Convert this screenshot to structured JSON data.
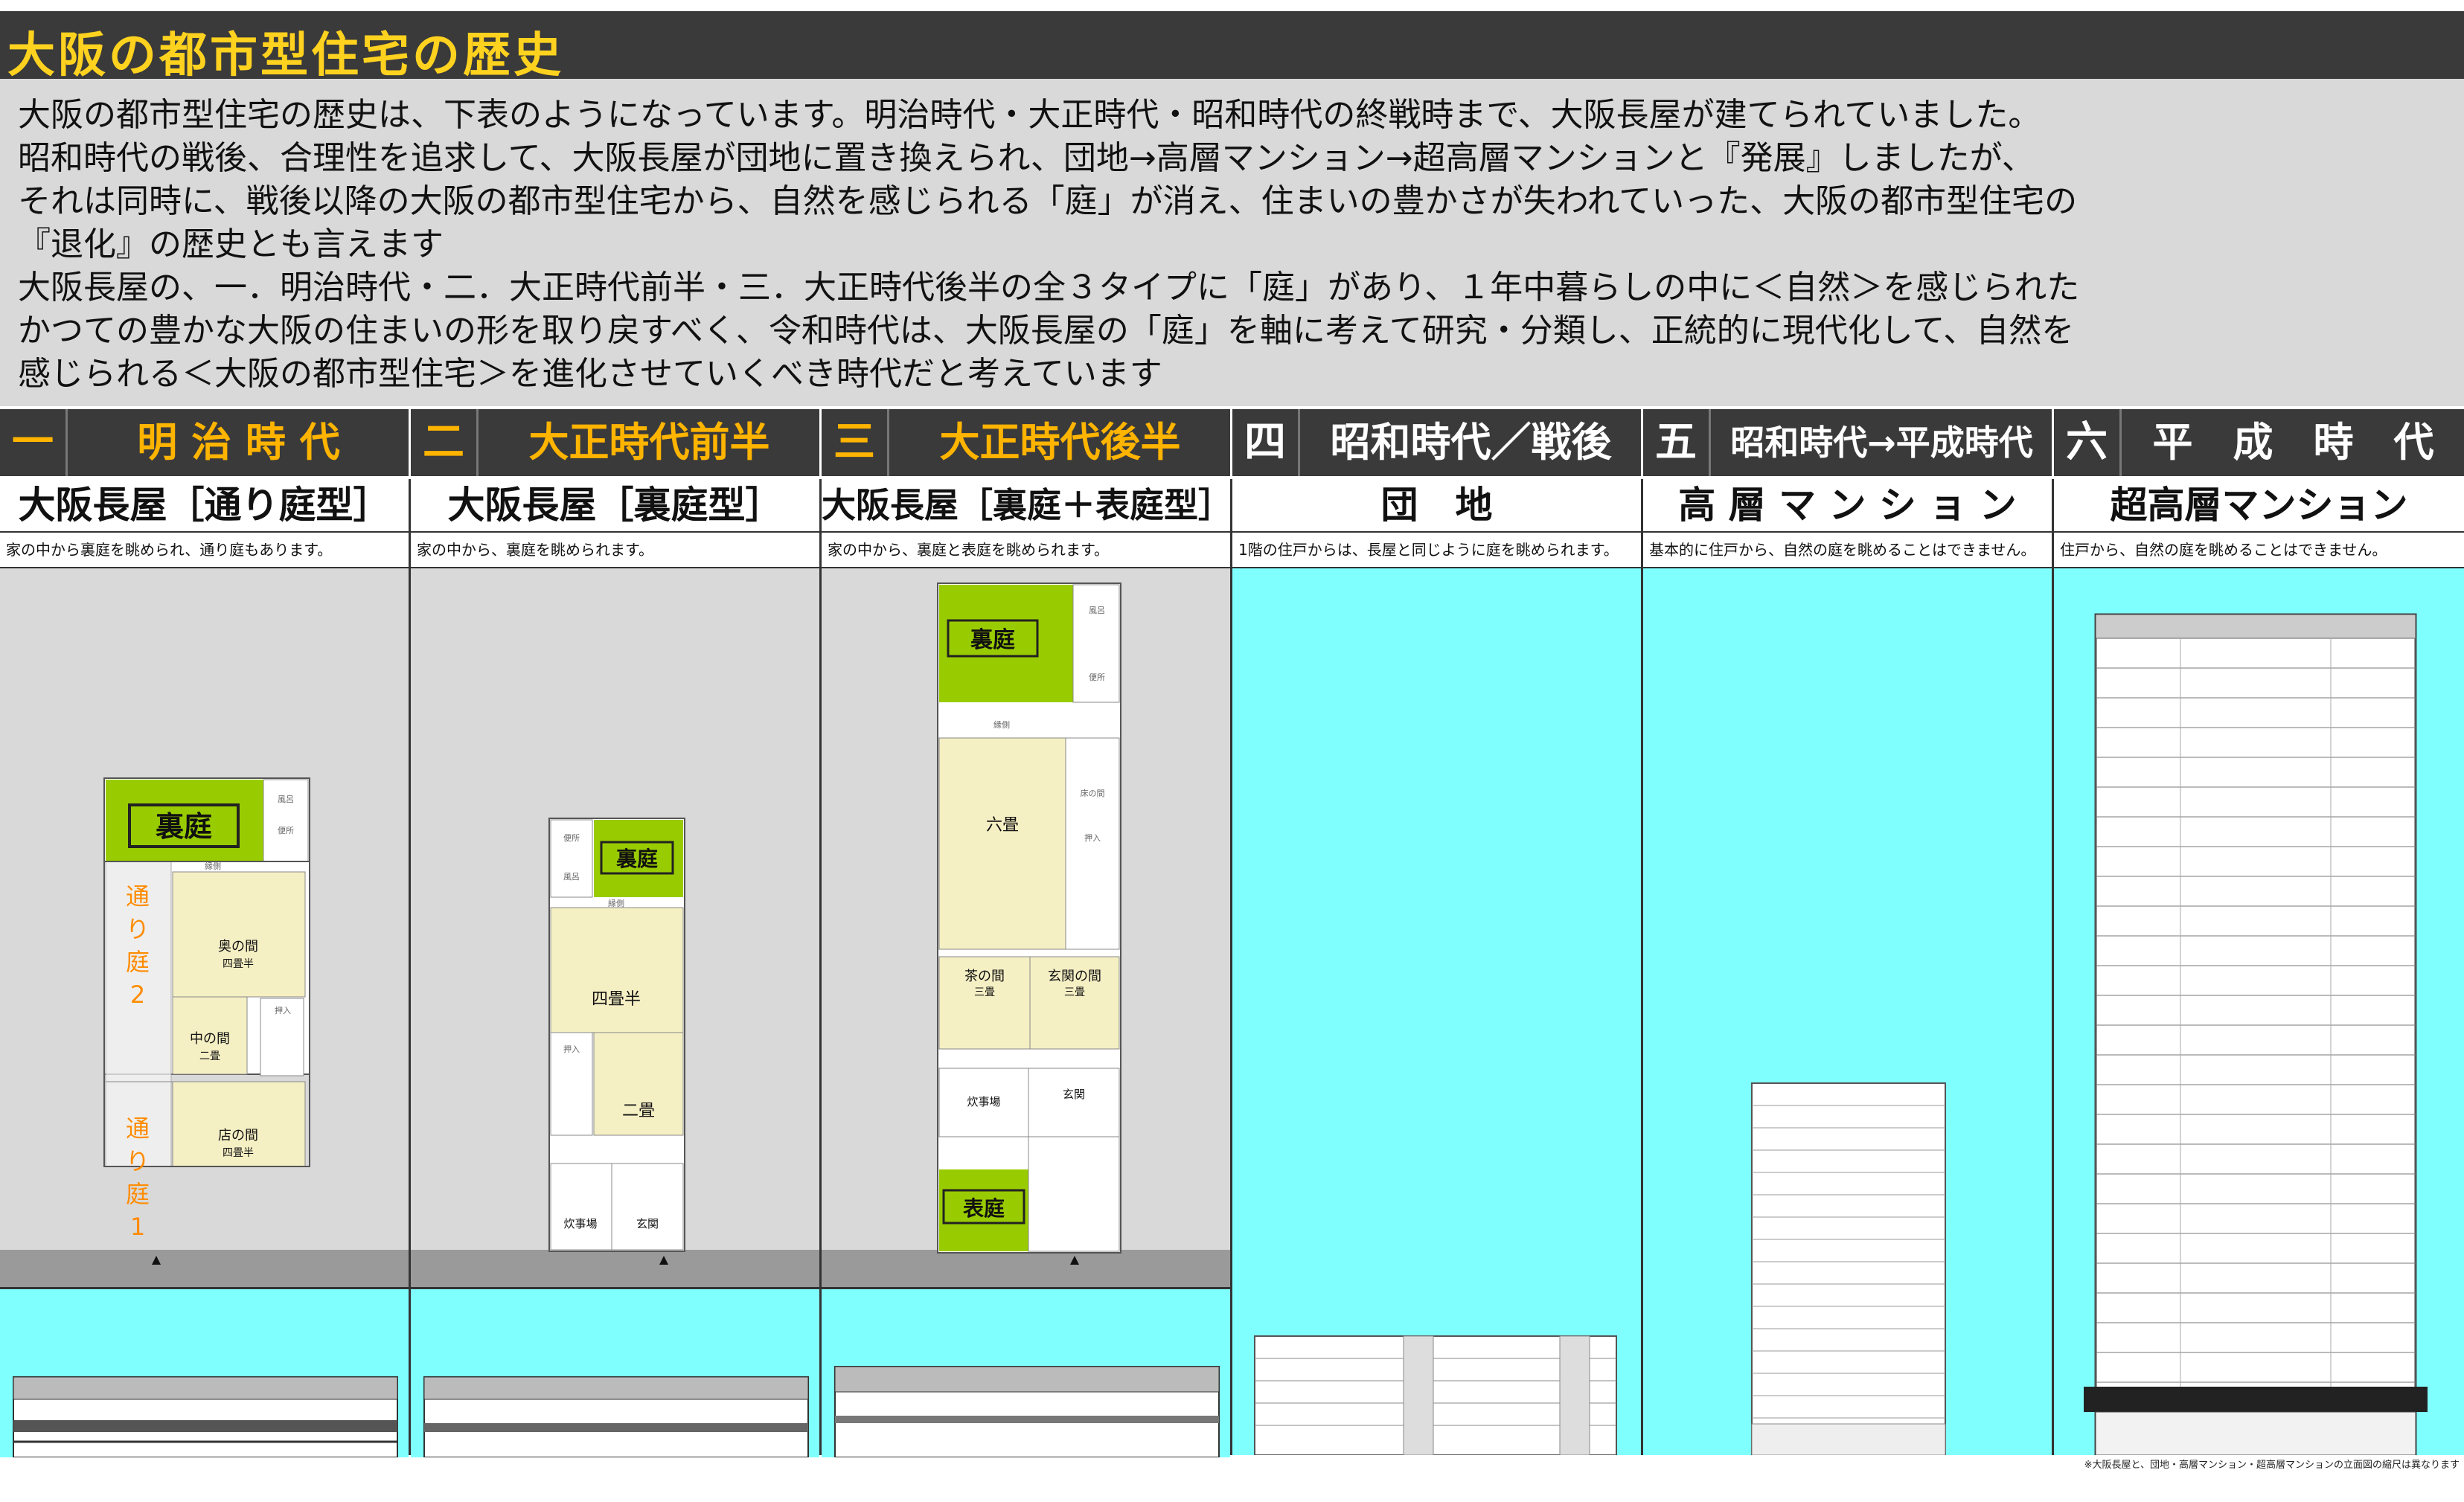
{
  "title": "大阪の都市型住宅の歴史",
  "intro_lines": [
    "大阪の都市型住宅の歴史は、下表のようになっています。明治時代・大正時代・昭和時代の終戦時まで、大阪長屋が建てられていました。",
    "昭和時代の戦後、合理性を追求して、大阪長屋が団地に置き換えられ、団地→高層マンション→超高層マンションと『発展』しましたが、",
    "それは同時に、戦後以降の大阪の都市型住宅から、自然を感じられる「庭」が消え、住まいの豊かさが失われていった、大阪の都市型住宅の",
    "『退化』の歴史とも言えます",
    "大阪長屋の、一．明治時代・二．大正時代前半・三．大正時代後半の全３タイプに「庭」があり、１年中暮らしの中に＜自然＞を感じられた",
    "かつての豊かな大阪の住まいの形を取り戻すべく、令和時代は、大阪長屋の「庭」を軸に考えて研究・分類し、正統的に現代化して、自然を",
    "感じられる＜大阪の都市型住宅＞を進化させていくべき時代だと考えています"
  ],
  "eras": [
    {
      "num": "一",
      "name": "明 治 時 代",
      "type": "大阪長屋［通り庭型］",
      "desc": "家の中から裏庭を眺められ、通り庭もあります。",
      "style": "orange"
    },
    {
      "num": "二",
      "name": "大正時代前半",
      "type": "大阪長屋［裏庭型］",
      "desc": "家の中から、裏庭を眺められます。",
      "style": "orange"
    },
    {
      "num": "三",
      "name": "大正時代後半",
      "type": "大阪長屋［裏庭＋表庭型］",
      "desc": "家の中から、裏庭と表庭を眺められます。",
      "style": "orange"
    },
    {
      "num": "四",
      "name": "昭和時代／戦後",
      "type": "団　地",
      "desc": "1階の住戸からは、長屋と同じように庭を眺められます。",
      "style": "white"
    },
    {
      "num": "五",
      "name": "昭和時代→平成時代",
      "type": "高 層 マ ン シ ョ ン",
      "desc": "基本的に住戸から、自然の庭を眺めることはできません。",
      "style": "white"
    },
    {
      "num": "六",
      "name": "平　成　時　代",
      "type": "超高層マンション",
      "desc": "住戸から、自然の庭を眺めることはできません。",
      "style": "white"
    }
  ],
  "plans": {
    "meiji": {
      "garden": "裏庭",
      "passage": [
        "通",
        "り",
        "庭",
        "2",
        "通",
        "り",
        "庭",
        "1"
      ],
      "rooms": [
        {
          "name": "奥の間",
          "size": "四畳半"
        },
        {
          "name": "中の間",
          "size": "二畳"
        },
        {
          "name": "店の間",
          "size": "四畳半"
        }
      ],
      "small": [
        "風呂",
        "便所",
        "縁側",
        "押入"
      ]
    },
    "taisho_early": {
      "garden": "裏庭",
      "rooms": [
        {
          "name": "四畳半"
        },
        {
          "name": "二畳"
        },
        {
          "name": "炊事場"
        },
        {
          "name": "玄関"
        }
      ],
      "small": [
        "便所",
        "風呂",
        "縁側",
        "押入"
      ]
    },
    "taisho_late": {
      "garden_back": "裏庭",
      "garden_front": "表庭",
      "rooms": [
        {
          "name": "六畳"
        },
        {
          "name": "茶の間",
          "size": "三畳"
        },
        {
          "name": "玄関の間",
          "size": "三畳"
        },
        {
          "name": "炊事場"
        },
        {
          "name": "玄関"
        }
      ],
      "small": [
        "床の間",
        "押入",
        "縁側",
        "風呂",
        "便所"
      ]
    }
  },
  "footnote": "※大阪長屋と、団地・高層マンション・超高層マンションの立面図の縮尺は異なります",
  "colors": {
    "title_bar": "#3a3a3a",
    "title_text": "#ffd21f",
    "era_orange": "#ffb400",
    "intro_bg": "#d9d9d9",
    "sky": "#80ffff",
    "garden": "#99cc00",
    "tatami": "#f5efc4"
  }
}
